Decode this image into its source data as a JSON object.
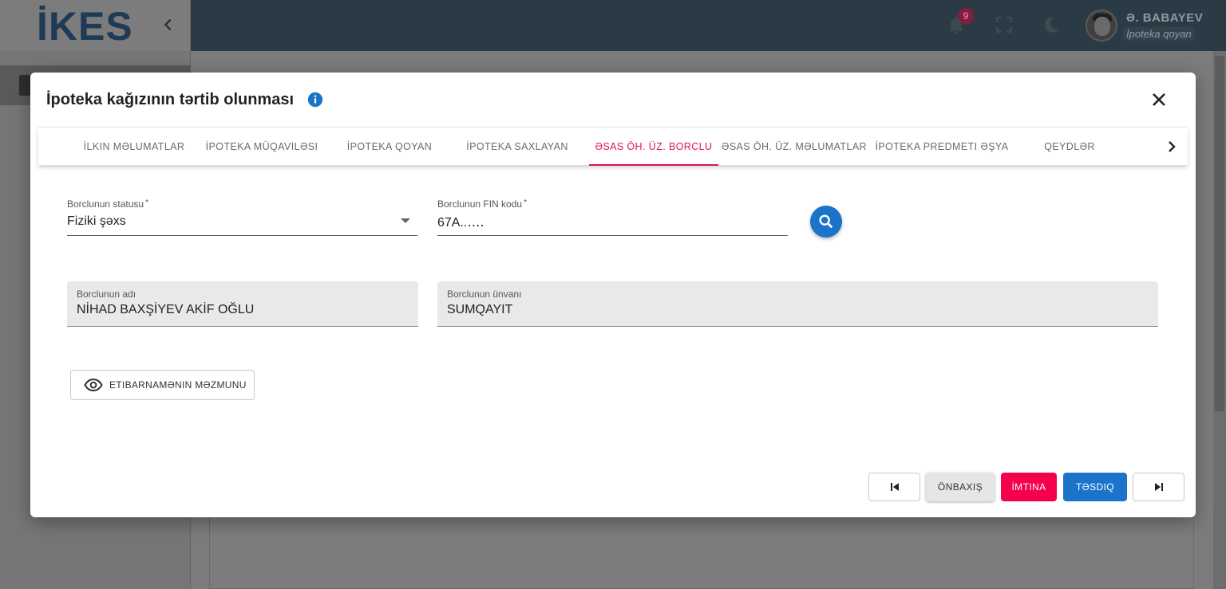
{
  "app": {
    "logo": "İKES",
    "notifications_count": "9",
    "user_name": "Ə. BABAYEV",
    "user_role": "İpoteka qoyan"
  },
  "modal": {
    "title": "İpoteka kağızının tərtib olunması",
    "tabs": [
      {
        "label": "İlkin məlumatlar",
        "active": false
      },
      {
        "label": "İpoteka müqaviləsi",
        "active": false
      },
      {
        "label": "İpoteka qoyan",
        "active": false
      },
      {
        "label": "İpoteka saxlayan",
        "active": false
      },
      {
        "label": "Əsas öh. üz. borclu",
        "active": true
      },
      {
        "label": "Əsas öh. üz. məlumatlar",
        "active": false
      },
      {
        "label": "İpoteka predmeti əşya",
        "active": false
      },
      {
        "label": "Qeydlər",
        "active": false
      }
    ],
    "form": {
      "status_label": "Borclunun statusu",
      "status_value": "Fiziki şəxs",
      "fin_label": "Borclunun FIN kodu",
      "fin_value": "67A..‥‥",
      "name_label": "Borclunun adı",
      "name_value": "NİHAD BAXŞİYEV AKİF OĞLU",
      "address_label": "Borclunun ünvanı",
      "address_value": "SUMQAYIT",
      "required_mark": "*",
      "proxy_button": "Etibarnamənin məzmunu"
    },
    "footer": {
      "preview": "Önbaxış",
      "cancel": "İmtina",
      "confirm": "Təsdiq"
    }
  },
  "colors": {
    "accent_active_tab": "#e0144c",
    "primary": "#1b74c9",
    "cancel": "#f5004d"
  }
}
